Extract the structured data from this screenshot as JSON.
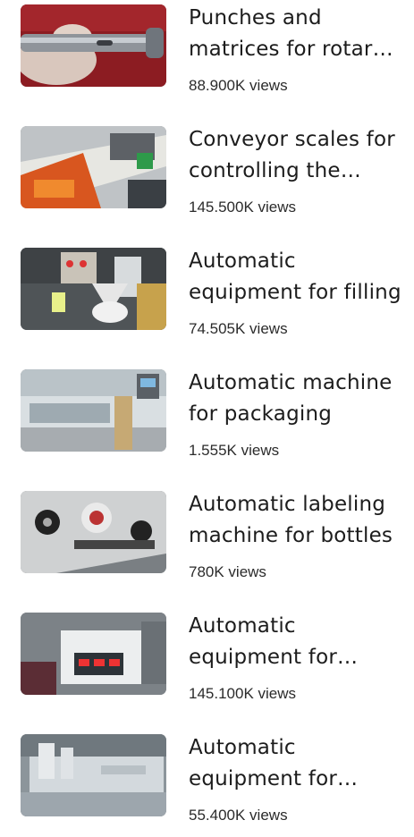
{
  "videos": [
    {
      "title": "Punches and matrices for rotary tablet press",
      "views": "88.900K views",
      "thumb": "punch-tool-image"
    },
    {
      "title": "Conveyor scales for controlling the weight",
      "views": "145.500K views",
      "thumb": "conveyor-scale-image"
    },
    {
      "title": "Automatic equipment for filling",
      "views": "74.505K views",
      "thumb": "filling-equipment-image"
    },
    {
      "title": "Automatic machine for packaging",
      "views": "1.555K views",
      "thumb": "packaging-machine-image"
    },
    {
      "title": "Automatic labeling machine for bottles",
      "views": "780K views",
      "thumb": "labeling-machine-image"
    },
    {
      "title": "Automatic equipment for sealing",
      "views": "145.100K views",
      "thumb": "control-panel-image"
    },
    {
      "title": "Automatic equipment for blister packing",
      "views": "55.400K views",
      "thumb": "blister-machine-image"
    }
  ],
  "colors": {
    "text": "#1c1c1c",
    "background": "#ffffff"
  }
}
